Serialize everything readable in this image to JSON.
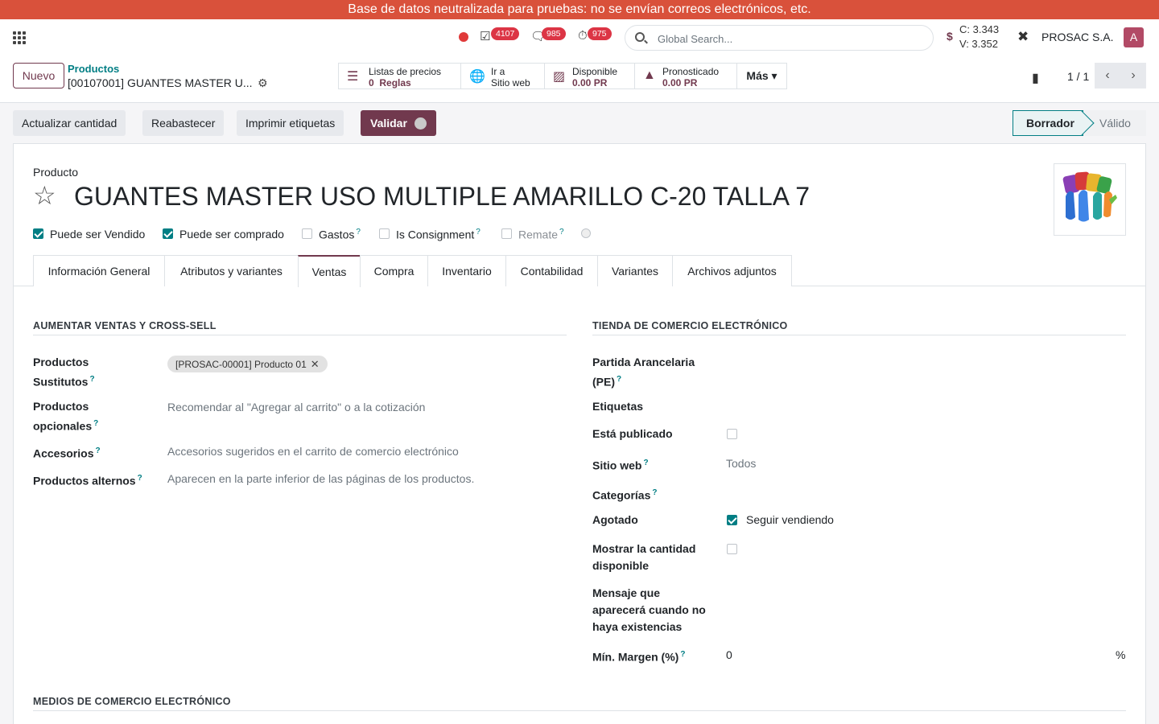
{
  "banner": {
    "text": "Base de datos neutralizada para pruebas: no se envían correos electrónicos, etc."
  },
  "navbar": {
    "activities_count": "4107",
    "messages_count": "985",
    "timer_count": "975",
    "search_placeholder": "Global Search...",
    "currency_symbol": "$",
    "rate_c": "C: 3.343",
    "rate_v": "V: 3.352",
    "company": "PROSAC S.A.",
    "user_initial": "A"
  },
  "control": {
    "new_label": "Nuevo",
    "breadcrumb_parent": "Productos",
    "breadcrumb_current": "[00107001] GUANTES MASTER U...",
    "smart_buttons": [
      {
        "line1": "Listas de precios",
        "count": "0",
        "line2": "Reglas",
        "icon": "list-icon"
      },
      {
        "line1": "Ir a",
        "line2": "Sitio web",
        "icon": "globe-icon"
      },
      {
        "line1": "Disponible",
        "line2": "0.00 PR",
        "icon": "cubes-icon"
      },
      {
        "line1": "Pronosticado",
        "line2": "0.00 PR",
        "icon": "area-chart-icon"
      }
    ],
    "more_label": "Más",
    "pager": "1 / 1"
  },
  "actions": {
    "update_qty": "Actualizar cantidad",
    "replenish": "Reabastecer",
    "print_labels": "Imprimir etiquetas",
    "validate": "Validar"
  },
  "stages": {
    "active": "Borrador",
    "next": "Válido"
  },
  "product": {
    "label": "Producto",
    "name": "GUANTES MASTER USO MULTIPLE AMARILLO C-20 TALLA 7",
    "checks": [
      {
        "label": "Puede ser Vendido",
        "checked": true
      },
      {
        "label": "Puede ser comprado",
        "checked": true
      },
      {
        "label": "Gastos",
        "checked": false
      },
      {
        "label": "Is Consignment",
        "checked": false
      },
      {
        "label": "Remate",
        "checked": false
      }
    ]
  },
  "tabs": [
    "Información General",
    "Atributos y variantes",
    "Ventas",
    "Compra",
    "Inventario",
    "Contabilidad",
    "Variantes",
    "Archivos adjuntos"
  ],
  "active_tab": "Ventas",
  "left_section": {
    "title": "AUMENTAR VENTAS Y CROSS-SELL",
    "substitutes_label_1": "Productos",
    "substitutes_label_2": "Sustitutos",
    "substitute_tag": "[PROSAC-00001] Producto 01",
    "optional_label_1": "Productos",
    "optional_label_2": "opcionales",
    "optional_placeholder": "Recomendar al \"Agregar al carrito\" o a la cotización",
    "accessories_label": "Accesorios",
    "accessories_placeholder": "Accesorios sugeridos en el carrito de comercio electrónico",
    "alternates_label": "Productos alternos",
    "alternates_placeholder": "Aparecen en la parte inferior de las páginas de los productos."
  },
  "right_section": {
    "title": "TIENDA DE COMERCIO ELECTRÓNICO",
    "tariff_label_1": "Partida Arancelaria",
    "tariff_label_2": "(PE)",
    "tags_label": "Etiquetas",
    "published_label": "Está publicado",
    "website_label": "Sitio web",
    "website_value": "Todos",
    "categories_label": "Categorías",
    "out_of_stock_label": "Agotado",
    "continue_selling": "Seguir vendiendo",
    "show_qty_label_1": "Mostrar la cantidad",
    "show_qty_label_2": "disponible",
    "message_label_1": "Mensaje que",
    "message_label_2": "aparecerá cuando no",
    "message_label_3": "haya existencias",
    "min_margin_label": "Mín. Margen (%)",
    "min_margin_value": "0",
    "percent": "%"
  },
  "media_section": {
    "title": "MEDIOS DE COMERCIO ELECTRÓNICO"
  },
  "colors": {
    "primary": "#71394e",
    "accent": "#017e84",
    "banner": "#d9513b"
  }
}
